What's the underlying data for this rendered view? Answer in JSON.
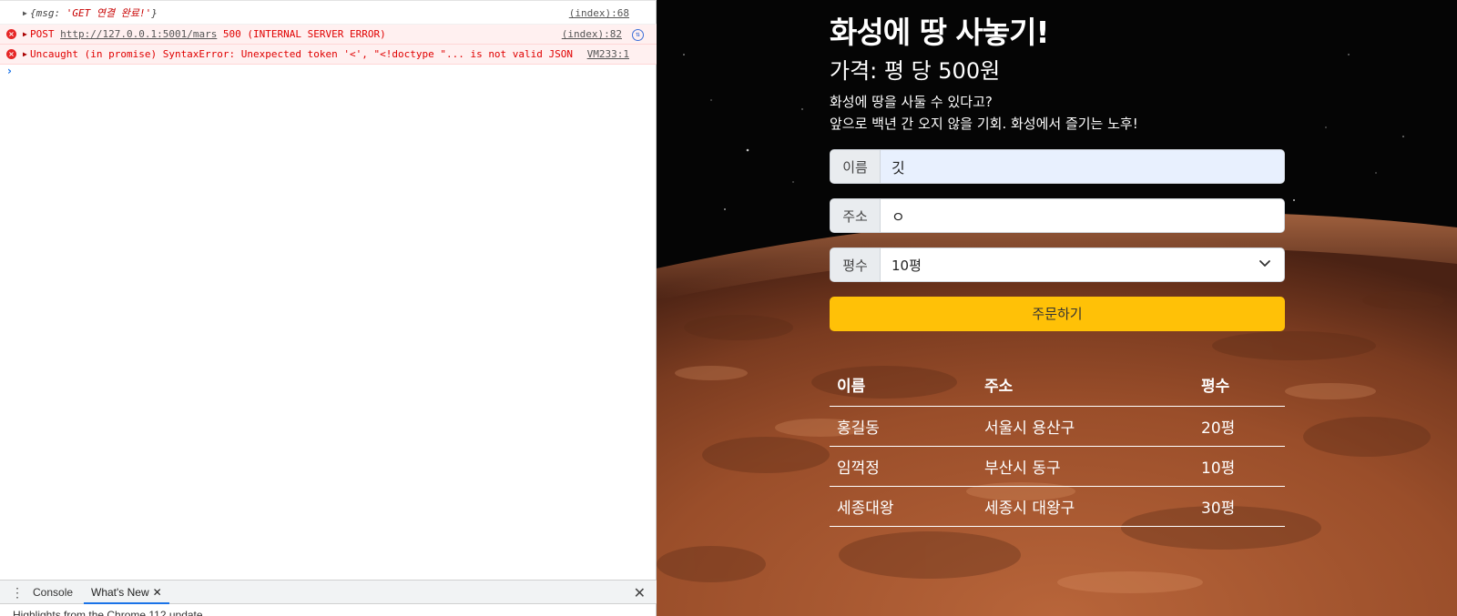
{
  "devtools": {
    "console": [
      {
        "type": "log",
        "text_prefix": "{msg: ",
        "text_string": "'GET 연결 완료!'",
        "text_suffix": "}",
        "source": "(index):68"
      },
      {
        "type": "error",
        "text_prefix": "POST ",
        "url": "http://127.0.0.1:5001/mars",
        "text_suffix": " 500 (INTERNAL SERVER ERROR)",
        "source": "(index):82"
      },
      {
        "type": "error",
        "text_prefix": "Uncaught (in promise) SyntaxError: Unexpected token '<', \"<!doctype \"... is not valid JSON",
        "source": "VM233:1"
      }
    ],
    "prompt": "›",
    "drawer": {
      "tabs": [
        {
          "label": "Console"
        },
        {
          "label": "What's New"
        }
      ],
      "tab_close": "✕",
      "close": "✕",
      "content_text": "Highlights from the Chrome 112 update"
    }
  },
  "page": {
    "title": "화성에 땅 사놓기!",
    "price": "가격: 평 당 500원",
    "desc_line1": "화성에 땅을 사둘 수 있다고?",
    "desc_line2": "앞으로 백년 간 오지 않을 기회. 화성에서 즐기는 노후!",
    "form": {
      "name_label": "이름",
      "name_value": "깃",
      "address_label": "주소",
      "address_value": "ㅇ",
      "size_label": "평수",
      "size_value": "10평",
      "order_button": "주문하기"
    },
    "table": {
      "headers": [
        "이름",
        "주소",
        "평수"
      ],
      "rows": [
        [
          "홍길동",
          "서울시 용산구",
          "20평"
        ],
        [
          "임꺽정",
          "부산시 동구",
          "10평"
        ],
        [
          "세종대왕",
          "세종시 대왕구",
          "30평"
        ]
      ]
    },
    "colors": {
      "order_button": "#ffc107",
      "mars_surface": "#a0502a",
      "space": "#050505"
    }
  }
}
